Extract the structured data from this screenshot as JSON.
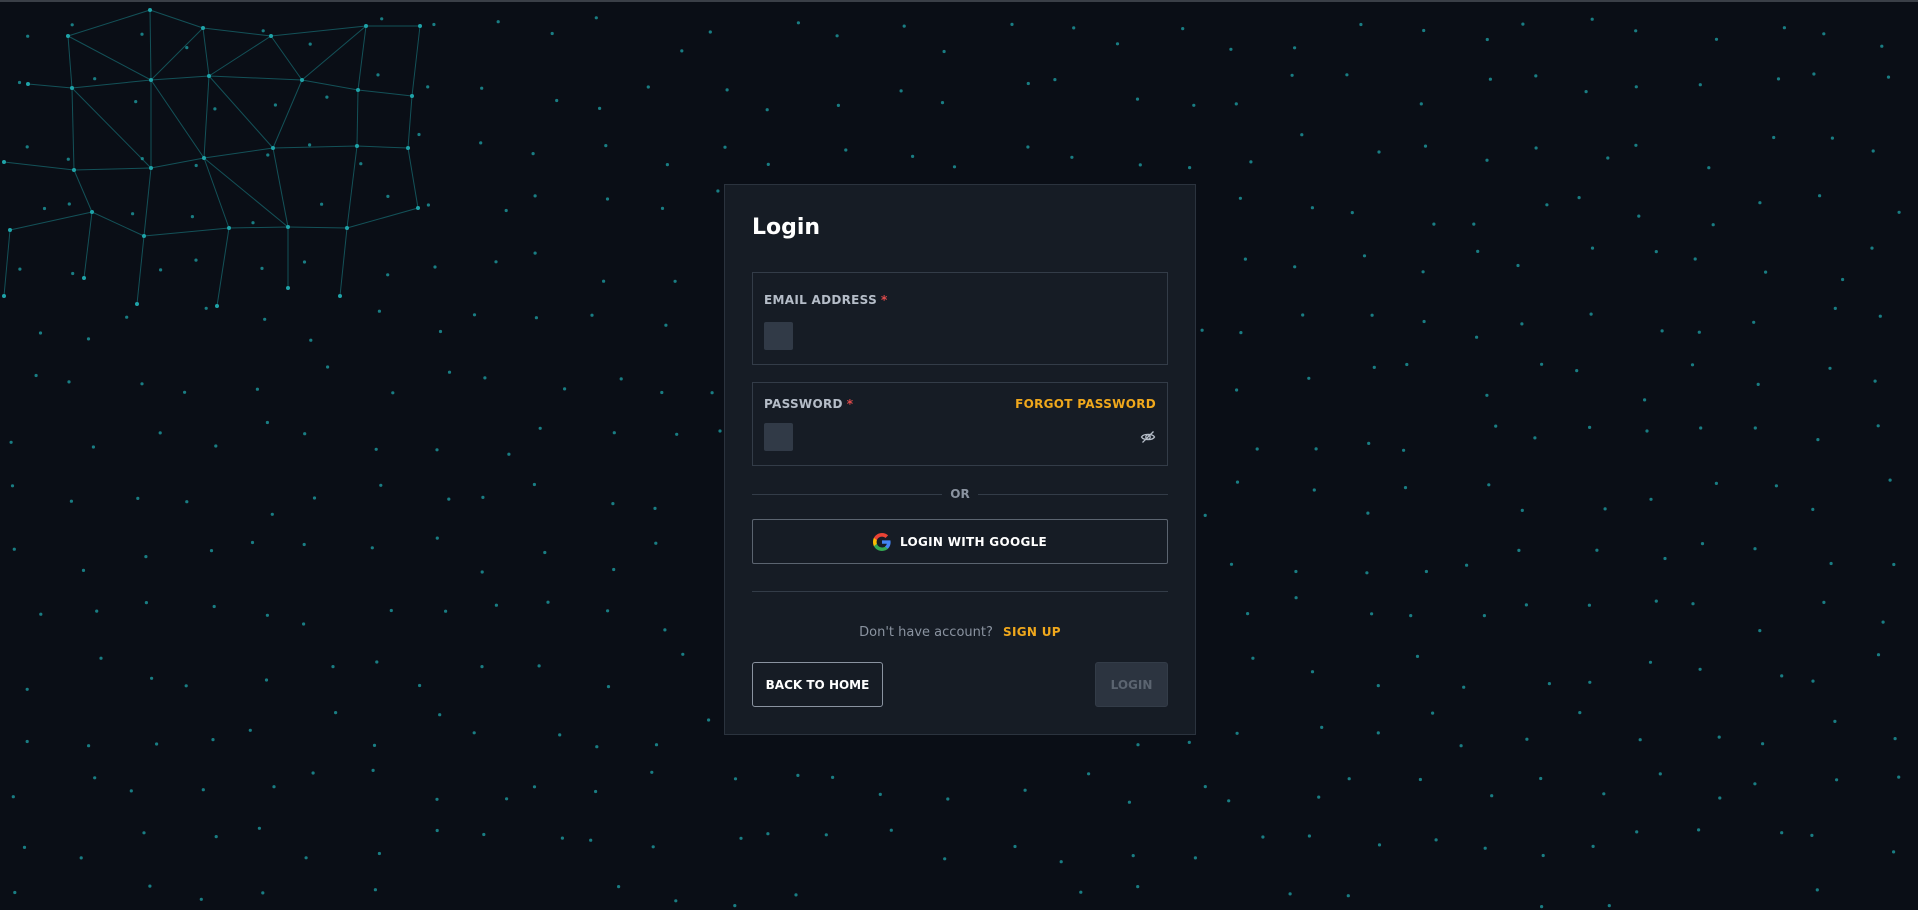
{
  "login": {
    "title": "Login",
    "email_label": "EMAIL ADDRESS",
    "email_value": "",
    "password_label": "PASSWORD",
    "password_value": "",
    "required_marker": "*",
    "forgot_password": "FORGOT PASSWORD",
    "or_text": "OR",
    "google_button": "LOGIN WITH GOOGLE",
    "no_account_text": "Don't have account?",
    "signup_link": "SIGN UP",
    "back_button": "BACK TO HOME",
    "login_button": "LOGIN"
  },
  "icons": {
    "password_toggle": "eye-slash-icon",
    "google": "google-icon"
  },
  "colors": {
    "background": "#0a0e16",
    "card": "#161c25",
    "accent": "#f0a81c",
    "required": "#e04b4b",
    "network": "#1fa3a8"
  }
}
